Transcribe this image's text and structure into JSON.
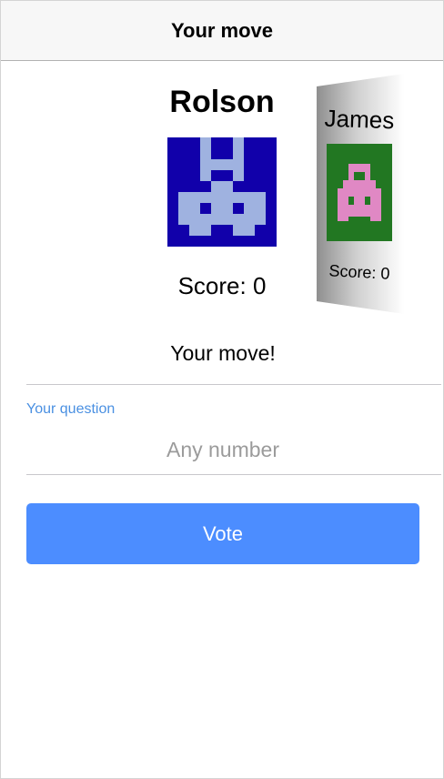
{
  "header": {
    "title": "Your move"
  },
  "current_player": {
    "name": "Rolson",
    "score_text": "Score: 0",
    "avatar": {
      "icon": "pixel-robot-icon",
      "background": "#1100aa",
      "foreground": "#9fb2e0"
    }
  },
  "next_player": {
    "name": "James",
    "score_text": "Score: 0",
    "avatar": {
      "icon": "pixel-creature-icon",
      "background": "#227722",
      "foreground": "#e088c4"
    }
  },
  "status": {
    "text": "Your move!"
  },
  "question_field": {
    "label": "Your question",
    "placeholder": "Any number",
    "value": ""
  },
  "vote_button": {
    "label": "Vote"
  },
  "colors": {
    "accent": "#4c8dff",
    "label_blue": "#4a90e2",
    "navbar_bg": "#f7f7f7",
    "placeholder": "#9b9b9b"
  }
}
